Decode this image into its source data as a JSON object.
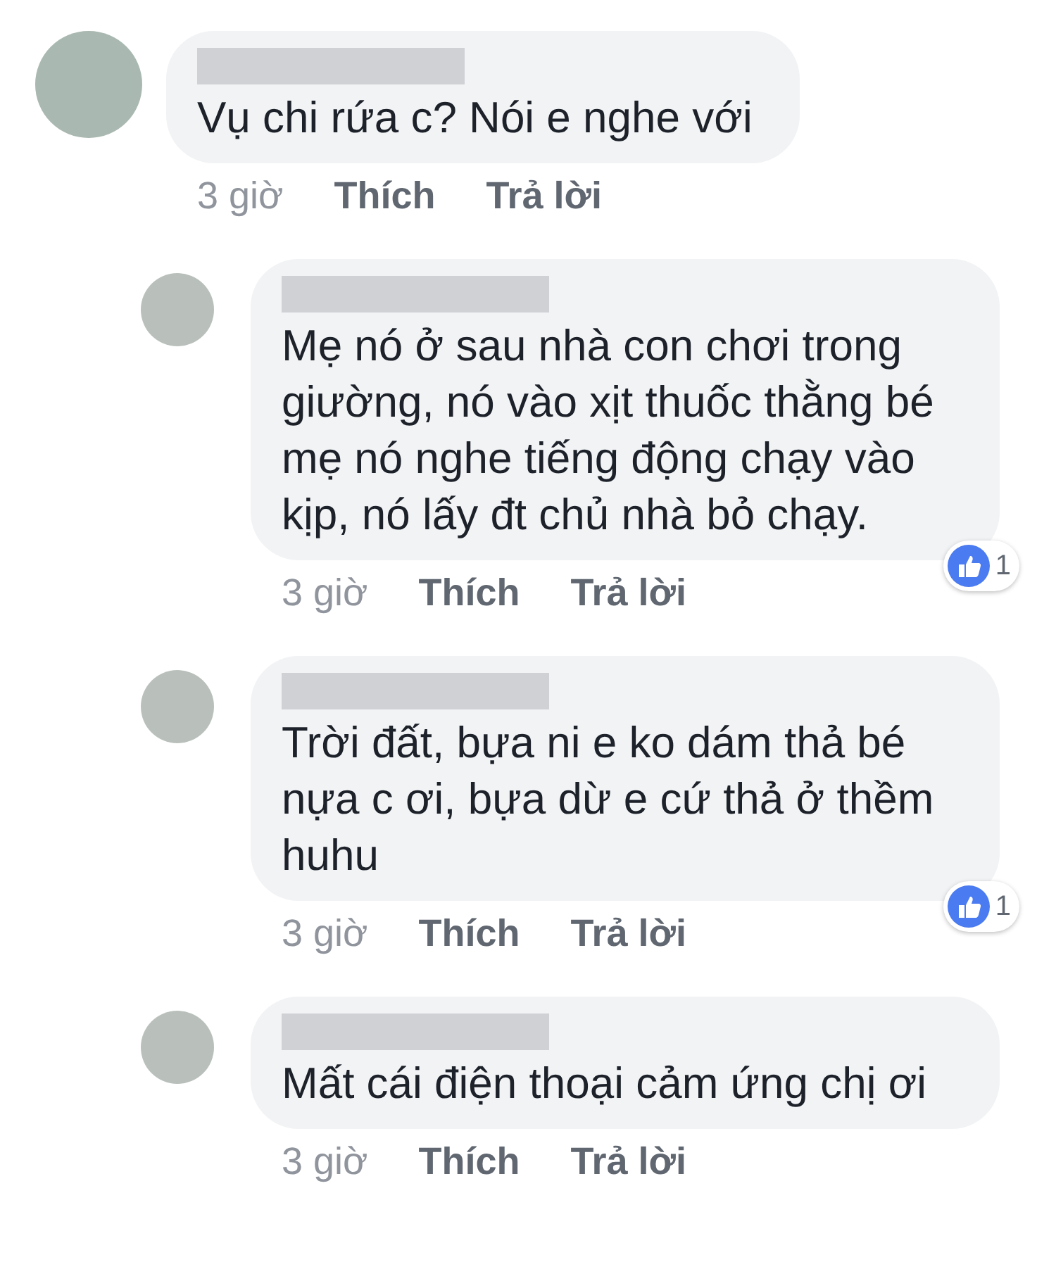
{
  "comments": [
    {
      "kind": "comment",
      "text": "Vụ chi rứa c? Nói e nghe với",
      "time": "3 giờ",
      "like": "Thích",
      "reply": "Trả lời"
    },
    {
      "kind": "reply",
      "text": "Mẹ nó ở sau nhà con chơi trong giường, nó vào xịt thuốc thằng bé mẹ nó nghe tiếng động chạy vào kịp, nó lấy đt chủ nhà bỏ chạy.",
      "time": "3 giờ",
      "like": "Thích",
      "reply": "Trả lời",
      "reactions": "1"
    },
    {
      "kind": "reply",
      "text": "Trời đất, bựa ni e ko dám thả bé nựa c ơi, bựa dừ e cứ thả ở thềm huhu",
      "time": "3 giờ",
      "like": "Thích",
      "reply": "Trả lời",
      "reactions": "1"
    },
    {
      "kind": "reply",
      "text": "Mất cái điện thoại cảm ứng chị ơi",
      "time": "3 giờ",
      "like": "Thích",
      "reply": "Trả lời"
    }
  ]
}
